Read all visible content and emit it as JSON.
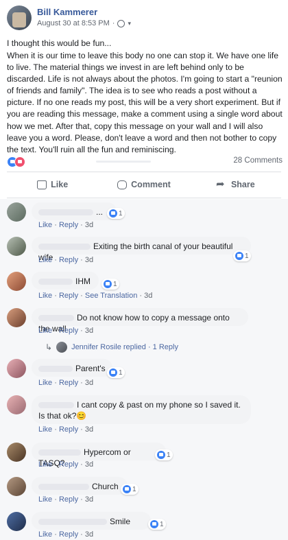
{
  "post": {
    "author": "Bill Kammerer",
    "date": "August 30 at 8:53 PM",
    "first_line": "I thought this would be fun...",
    "body": "When it is our time to leave this body no one can stop it. We have one life to live. The material things we invest in are left behind only to be discarded. Life is not always about the photos. I'm going to start a \"reunion of friends and family\". The idea is to see who reads a post without a picture. If no one reads my post, this will be a very short experiment. But if you are reading this message, make a comment using a single word about how we met. After that, copy this message on your wall and I will also leave you a word. Please, don't leave a word and then not bother to copy the text. You'll ruin all the fun and reminiscing.",
    "comments_count": "28 Comments"
  },
  "actions": {
    "like": "Like",
    "comment": "Comment",
    "share": "Share"
  },
  "comments": [
    {
      "text": "...",
      "likes": "1",
      "like": "Like",
      "reply": "Reply",
      "time": "3d"
    },
    {
      "text": "Exiting the birth canal of your beautiful wife",
      "likes": "1",
      "like": "Like",
      "reply": "Reply",
      "time": "3d"
    },
    {
      "text": "IHM",
      "likes": "1",
      "like": "Like",
      "reply": "Reply",
      "extra": "See Translation",
      "time": "3d"
    },
    {
      "text": "Do not know how to copy a message onto the wall",
      "like": "Like",
      "reply": "Reply",
      "time": "3d",
      "reply_summary": "Jennifer Rosile replied · 1 Reply"
    },
    {
      "text": "Parent's",
      "likes": "1",
      "like": "Like",
      "reply": "Reply",
      "time": "3d"
    },
    {
      "text": "I cant copy & past on my phone so I saved it. Is that ok?😊",
      "like": "Like",
      "reply": "Reply",
      "time": "3d"
    },
    {
      "text": "Hypercom or TASQ?",
      "likes": "1",
      "like": "Like",
      "reply": "Reply",
      "time": "3d"
    },
    {
      "text": "Church",
      "likes": "1",
      "like": "Like",
      "reply": "Reply",
      "time": "3d"
    },
    {
      "text": "Smile",
      "likes": "1",
      "like": "Like",
      "reply": "Reply",
      "time": "3d"
    }
  ],
  "colors": {
    "link": "#365899",
    "like_blue": "#3b82f6",
    "love_red": "#f0506e"
  }
}
